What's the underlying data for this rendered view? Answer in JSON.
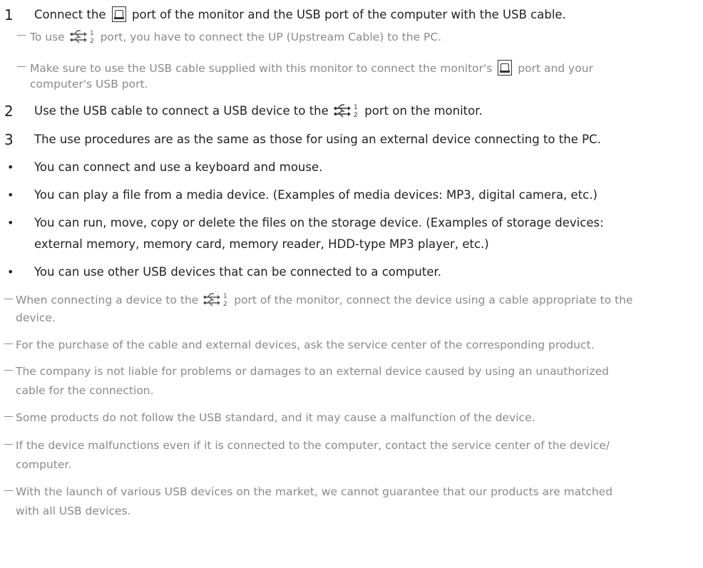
{
  "steps": [
    {
      "number": "1",
      "before": "Connect the",
      "after": "port of the monitor and the USB port of the computer with the USB cable."
    },
    {
      "number": "2",
      "before": "Use the USB cable to connect a USB device to the",
      "after": "port on the monitor."
    },
    {
      "number": "3",
      "text": "The use procedures are as the same as those for using an external device connecting to the PC."
    }
  ],
  "step1_notes": [
    {
      "before": "To use",
      "after": "port, you have to connect the UP (Upstream Cable) to the PC."
    },
    {
      "before": "Make sure to use the USB cable supplied with this monitor to connect the monitor's",
      "after": "port and your",
      "line2": "computer's USB port."
    }
  ],
  "bullets": [
    {
      "line1": "You can connect and use a keyboard and mouse."
    },
    {
      "line1": "You can play a file from a media device. (Examples of media devices: MP3, digital camera, etc.)"
    },
    {
      "line1": "You can run, move, copy or delete the files on the storage device. (Examples of storage devices:",
      "line2": "external memory, memory card, memory reader, HDD-type MP3 player, etc.)"
    },
    {
      "line1": "You can use other USB devices that can be connected to a computer."
    }
  ],
  "notes": [
    {
      "before": "When connecting a device to the",
      "after": "port of the monitor, connect the device using a cable appropriate to the",
      "line2": "device."
    },
    {
      "line1": "For the purchase of the cable and external devices, ask the service center of the corresponding product."
    },
    {
      "line1": "The company is not liable for problems or damages to an external device caused by using an unauthorized",
      "line2": "cable for the connection."
    },
    {
      "line1": "Some products do not follow the USB standard, and it may cause a malfunction of the device."
    },
    {
      "line1": "If the device malfunctions even if it is connected to the computer, contact the service center of the device/",
      "line2": "computer."
    },
    {
      "line1": "With the launch of various USB devices on the market, we cannot guarantee that our products are matched",
      "line2": "with all USB devices."
    }
  ],
  "icons": {
    "upstream_port": "usb-upstream-port-icon",
    "downstream_port": "usb-downstream-port-icon",
    "downstream_sub_1": "1",
    "downstream_sub_2": "2"
  },
  "colors": {
    "text": "#222222",
    "note_text": "#8a8a8a",
    "dash": "#8d8d8d"
  }
}
